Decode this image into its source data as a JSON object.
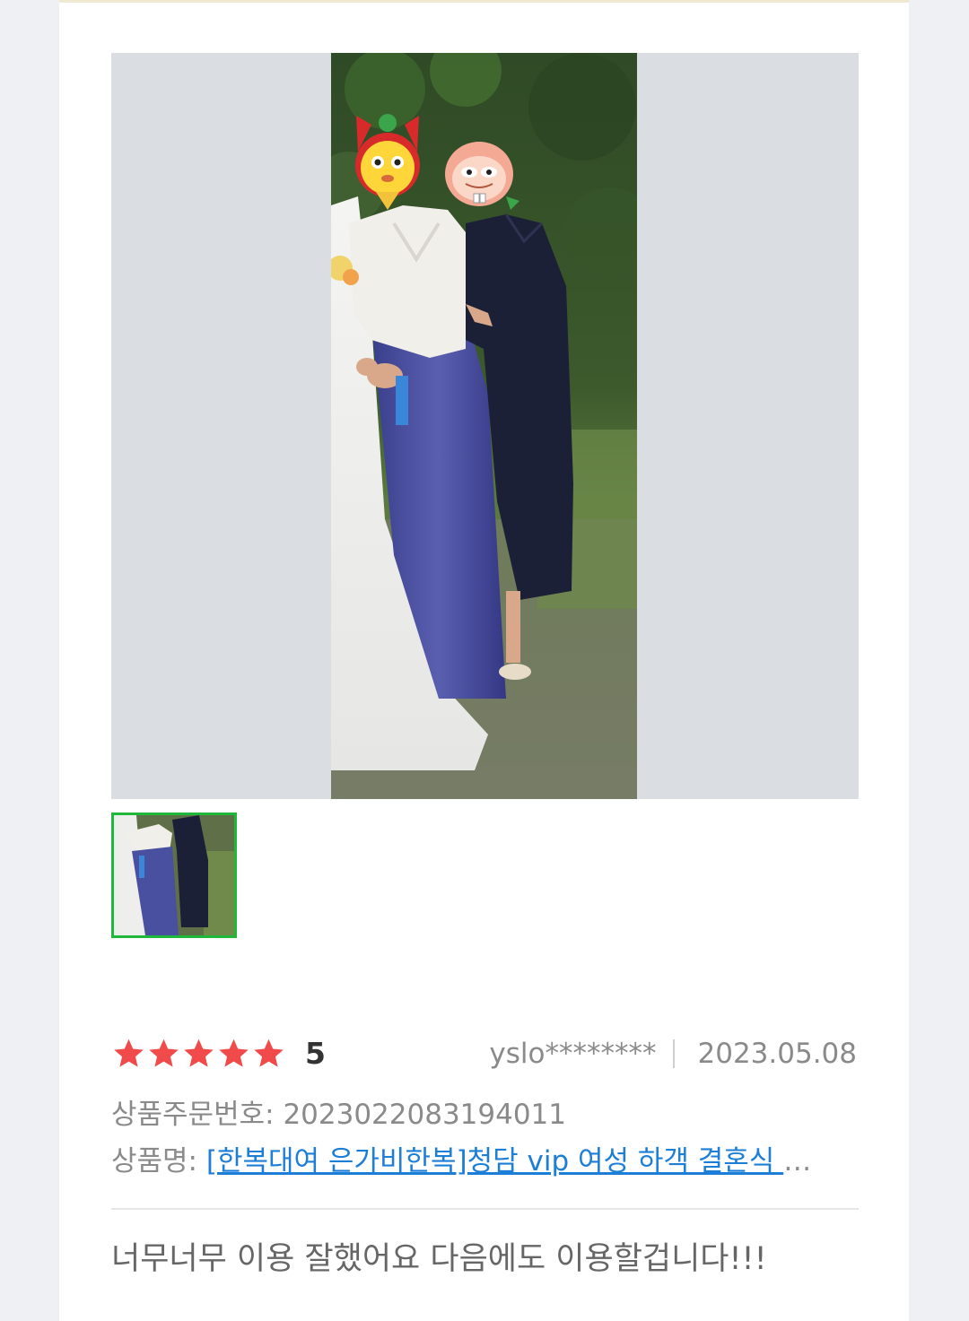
{
  "review": {
    "rating": 5,
    "rating_label": "5",
    "user": "yslo********",
    "date": "2023.05.08",
    "order_label": "상품주문번호:",
    "order_number": "2023022083194011",
    "product_label": "상품명:",
    "product_name": "[한복대여 은가비한복]청담 vip 여성 하객 결혼식 한복",
    "text": "너무너무 이용 잘했어요 다음에도 이용할겁니다!!!"
  },
  "colors": {
    "star": "#f04a4a",
    "link": "#1c7ed6",
    "thumb_border": "#1fb83a"
  },
  "icons": {
    "star": "star-icon"
  }
}
